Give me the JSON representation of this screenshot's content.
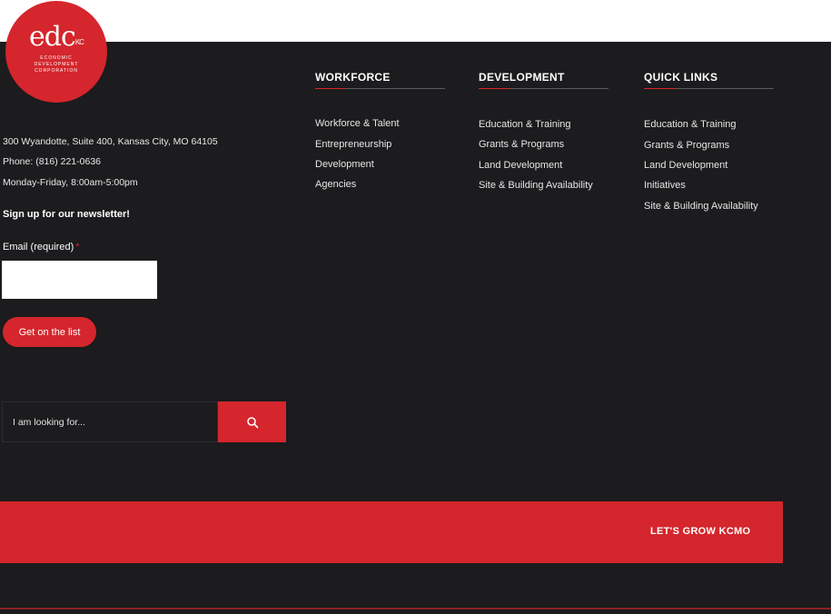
{
  "logo": {
    "mark": "edc",
    "badge": "KC",
    "subtitle_lines": [
      "ECONOMIC",
      "DEVELOPMENT",
      "CORPORATION"
    ]
  },
  "contact": {
    "address": "300 Wyandotte, Suite 400, Kansas City, MO 64105",
    "phone": "Phone: (816) 221-0636",
    "hours": "Monday-Friday, 8:00am-5:00pm"
  },
  "newsletter": {
    "title": "Sign up for our newsletter!",
    "email_label": "Email (required)",
    "required_mark": "*",
    "email_value": "",
    "button_label": "Get on the list"
  },
  "search": {
    "placeholder": "I am looking for...",
    "icon": "search-icon"
  },
  "columns": {
    "workforce": {
      "heading": "WORKFORCE",
      "links": [
        "Workforce & Talent",
        "Entrepreneurship",
        "Development",
        "Agencies"
      ]
    },
    "development": {
      "heading": "DEVELOPMENT",
      "links": [
        "Education & Training",
        "Grants & Programs",
        "Land Development",
        "Site & Building Availability"
      ]
    },
    "quick_links": {
      "heading": "QUICK LINKS",
      "links": [
        "Education & Training",
        "Grants & Programs",
        "Land Development",
        "Initiatives",
        "Site & Building Availability"
      ]
    }
  },
  "banner": {
    "label": "LET'S GROW KCMO"
  },
  "colors": {
    "brand_red": "#d4262c",
    "background": "#1c1b1d"
  }
}
